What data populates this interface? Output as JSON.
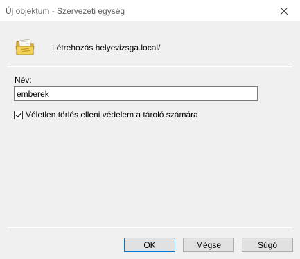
{
  "window": {
    "title": "Új objektum - Szervezeti egység"
  },
  "location": {
    "label": "Létrehozás helye:",
    "value": "vizsga.local/"
  },
  "name_field": {
    "label": "Név:",
    "value": "emberek"
  },
  "protect_checkbox": {
    "label": "Véletlen törlés elleni védelem a tároló számára",
    "checked": true
  },
  "buttons": {
    "ok": "OK",
    "cancel": "Mégse",
    "help": "Súgó"
  },
  "icons": {
    "folder": "organizational-unit-folder-icon",
    "close": "close-icon",
    "check": "checkmark-icon"
  },
  "colors": {
    "title_text": "#606060",
    "window_bg": "#f0f0f0",
    "button_bg": "#e1e1e1",
    "default_button_border": "#0078d7"
  }
}
